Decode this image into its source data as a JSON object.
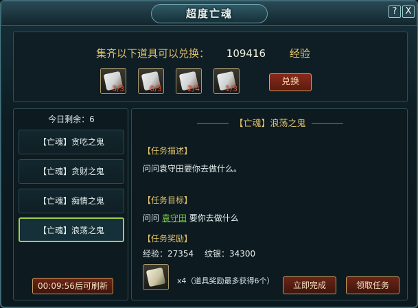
{
  "window": {
    "title": "超度亡魂",
    "help_label": "?",
    "close_label": "X"
  },
  "exchange": {
    "prefix": "集齐以下道具可以兑换：",
    "amount": "109416",
    "unit": "经验",
    "redeem_label": "兑换",
    "items": [
      {
        "icon": "scroll-icon",
        "count": "3/3"
      },
      {
        "icon": "scroll-icon",
        "count": "0/3"
      },
      {
        "icon": "scroll-icon",
        "count": "2/4"
      },
      {
        "icon": "scroll-icon",
        "count": "1/3"
      }
    ]
  },
  "sidebar": {
    "remaining": "今日剩余：6",
    "items": [
      {
        "label": "【亡魂】贪吃之鬼"
      },
      {
        "label": "【亡魂】贪财之鬼"
      },
      {
        "label": "【亡魂】痴情之鬼"
      },
      {
        "label": "【亡魂】浪荡之鬼"
      }
    ],
    "refresh_label": "00:09:56后可刷新"
  },
  "quest": {
    "title": "【亡魂】浪荡之鬼",
    "desc_header": "【任务描述】",
    "desc_text": "问问袁守田要你去做什么。",
    "goal_header": "【任务目标】",
    "goal_prefix": "问问",
    "goal_link": "袁守田",
    "goal_suffix": "要你去做什么",
    "reward_header": "【任务奖励】",
    "exp_text": "经验：27354",
    "silver_text": "纹银：34300",
    "reward_note": "x4（道具奖励最多获得6个）",
    "complete_label": "立即完成",
    "accept_label": "领取任务"
  },
  "colors": {
    "accent": "#e0c26a",
    "selected_border": "#9ed04a",
    "count_text": "#e8624c"
  }
}
